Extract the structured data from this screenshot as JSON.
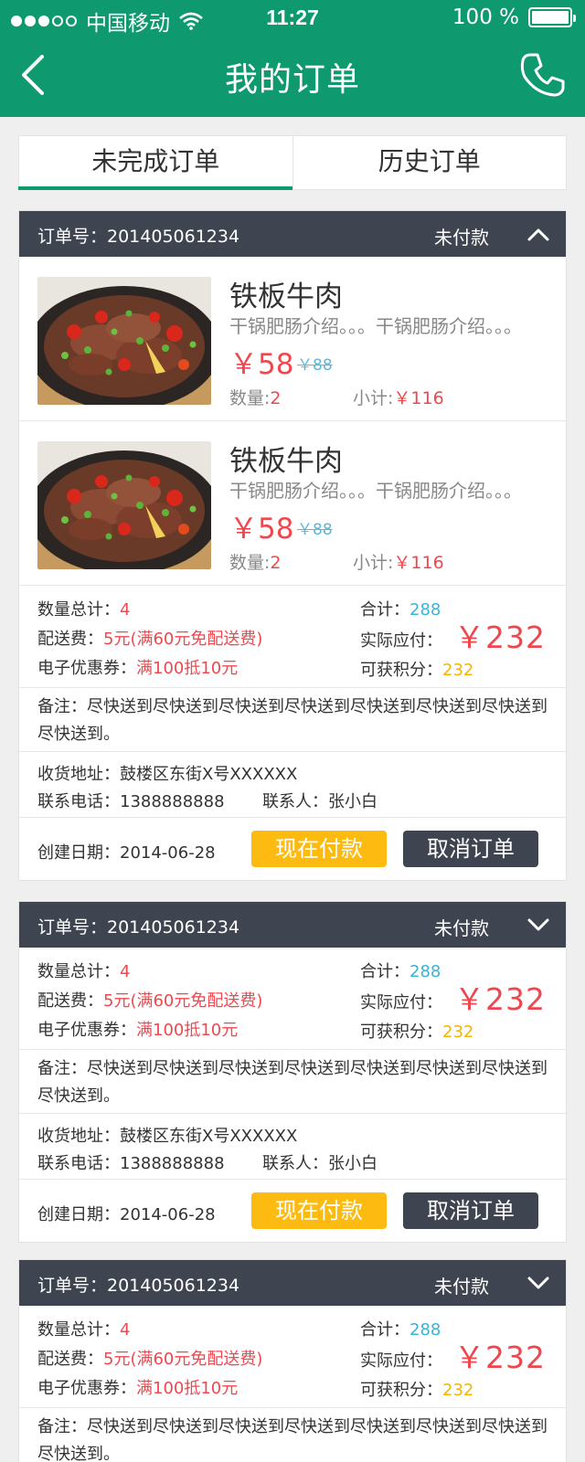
{
  "status_bar": {
    "carrier": "中国移动",
    "time": "11:27",
    "battery": "100 %"
  },
  "header": {
    "title": "我的订单"
  },
  "tabs": [
    {
      "label": "未完成订单",
      "active": true
    },
    {
      "label": "历史订单",
      "active": false
    }
  ],
  "orders": [
    {
      "order_no": "订单号：201405061234",
      "status": "未付款",
      "items": [
        {
          "name": "铁板牛肉",
          "desc": "干锅肥肠介绍。。。干锅肥肠介绍。。。",
          "price": "￥58",
          "original_price": "￥88",
          "qty_label": "数量:",
          "qty": "2",
          "subtotal_label": "小计:",
          "subtotal": "￥116"
        },
        {
          "name": "铁板牛肉",
          "desc": "干锅肥肠介绍。。。干锅肥肠介绍。。。",
          "price": "￥58",
          "original_price": "￥88",
          "qty_label": "数量:",
          "qty": "2",
          "subtotal_label": "小计:",
          "subtotal": "￥116"
        }
      ],
      "summary": {
        "count_label": "数量总计：",
        "count": "4",
        "delivery_label": "配送费：",
        "delivery": "5元(满60元免配送费)",
        "coupon_label": "电子优惠券：",
        "coupon": "满100抵10元",
        "total_label": "合计：",
        "total": "288",
        "pay_label": "实际应付：",
        "pay": "￥232",
        "points_label": "可获积分：",
        "points": "232"
      },
      "remark": "备注：尽快送到尽快送到尽快送到尽快送到尽快送到尽快送到尽快送到尽快送到。",
      "address": "收货地址：鼓楼区东街X号XXXXXX",
      "phone": "联系电话：1388888888",
      "contact": "联系人：张小白",
      "date": "创建日期：2014-06-28",
      "pay_button": "现在付款",
      "cancel_button": "取消订单"
    },
    {
      "order_no": "订单号：201405061234",
      "status": "未付款",
      "summary": {
        "count_label": "数量总计：",
        "count": "4",
        "delivery_label": "配送费：",
        "delivery": "5元(满60元免配送费)",
        "coupon_label": "电子优惠券：",
        "coupon": "满100抵10元",
        "total_label": "合计：",
        "total": "288",
        "pay_label": "实际应付：",
        "pay": "￥232",
        "points_label": "可获积分：",
        "points": "232"
      },
      "remark": "备注：尽快送到尽快送到尽快送到尽快送到尽快送到尽快送到尽快送到尽快送到。",
      "address": "收货地址：鼓楼区东街X号XXXXXX",
      "phone": "联系电话：1388888888",
      "contact": "联系人：张小白",
      "date": "创建日期：2014-06-28",
      "pay_button": "现在付款",
      "cancel_button": "取消订单"
    },
    {
      "order_no": "订单号：201405061234",
      "status": "未付款",
      "summary": {
        "count_label": "数量总计：",
        "count": "4",
        "delivery_label": "配送费：",
        "delivery": "5元(满60元免配送费)",
        "coupon_label": "电子优惠券：",
        "coupon": "满100抵10元",
        "total_label": "合计：",
        "total": "288",
        "pay_label": "实际应付：",
        "pay": "￥232",
        "points_label": "可获积分：",
        "points": "232"
      },
      "remark": "备注：尽快送到尽快送到尽快送到尽快送到尽快送到尽快送到尽快送到尽快送到。"
    }
  ],
  "colors": {
    "brand": "#0e9a6e",
    "header_dark": "#3f4550",
    "price_red": "#f0474e",
    "link_blue": "#39b3d6",
    "points_yellow": "#f5b400",
    "pay_button": "#fdbb12"
  },
  "icons": {
    "back": "chevron-left-icon",
    "phone": "phone-icon",
    "expand": "chevron-up-icon",
    "collapse": "chevron-down-icon",
    "wifi": "wifi-icon",
    "battery": "battery-icon"
  }
}
